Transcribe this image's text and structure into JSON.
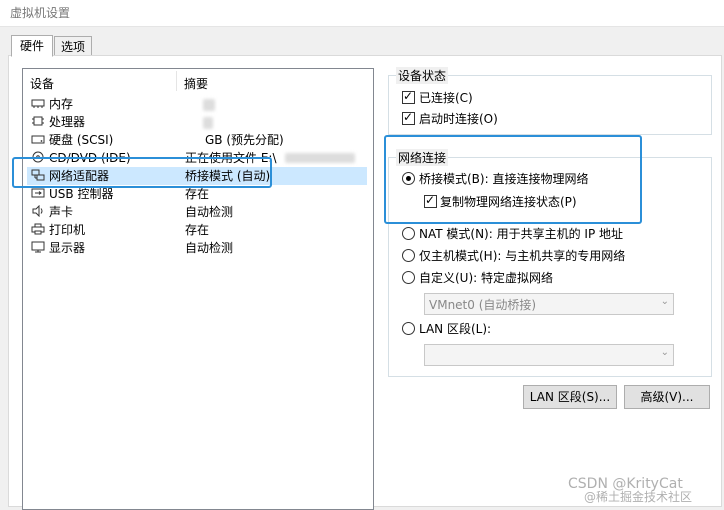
{
  "window": {
    "title": "虚拟机设置"
  },
  "tabs": [
    {
      "label": "硬件"
    },
    {
      "label": "选项"
    }
  ],
  "device_list": {
    "col_device": "设备",
    "col_summary": "摘要",
    "items": [
      {
        "name": "内存",
        "summary": "",
        "icon": "memory-icon"
      },
      {
        "name": "处理器",
        "summary": "",
        "icon": "cpu-icon"
      },
      {
        "name": "硬盘 (SCSI)",
        "summary": "GB (预先分配)",
        "icon": "hdd-icon"
      },
      {
        "name": "CD/DVD (IDE)",
        "summary": "正在使用文件 E:\\",
        "icon": "cdrom-icon"
      },
      {
        "name": "网络适配器",
        "summary": "桥接模式 (自动)",
        "icon": "network-icon"
      },
      {
        "name": "USB 控制器",
        "summary": "存在",
        "icon": "usb-icon"
      },
      {
        "name": "声卡",
        "summary": "自动检测",
        "icon": "sound-icon"
      },
      {
        "name": "打印机",
        "summary": "存在",
        "icon": "printer-icon"
      },
      {
        "name": "显示器",
        "summary": "自动检测",
        "icon": "monitor-icon"
      }
    ]
  },
  "device_status": {
    "title": "设备状态",
    "connected": {
      "label": "已连接(C)",
      "checked": true
    },
    "connect_on_power_on": {
      "label": "启动时连接(O)",
      "checked": true
    }
  },
  "network": {
    "title": "网络连接",
    "bridged": {
      "label": "桥接模式(B): 直接连接物理网络",
      "selected": true
    },
    "replicate": {
      "label": "复制物理网络连接状态(P)",
      "checked": true
    },
    "nat": {
      "label": "NAT 模式(N): 用于共享主机的 IP 地址",
      "selected": false
    },
    "host_only": {
      "label": "仅主机模式(H): 与主机共享的专用网络",
      "selected": false
    },
    "custom": {
      "label": "自定义(U): 特定虚拟网络",
      "selected": false
    },
    "custom_combo": "VMnet0 (自动桥接)",
    "lan": {
      "label": "LAN 区段(L):",
      "selected": false
    },
    "lan_combo": ""
  },
  "buttons": {
    "lan_segments": "LAN 区段(S)...",
    "advanced": "高级(V)..."
  },
  "watermark": "CSDN @KrityCat",
  "watermark2": "@稀土掘金技术社区"
}
